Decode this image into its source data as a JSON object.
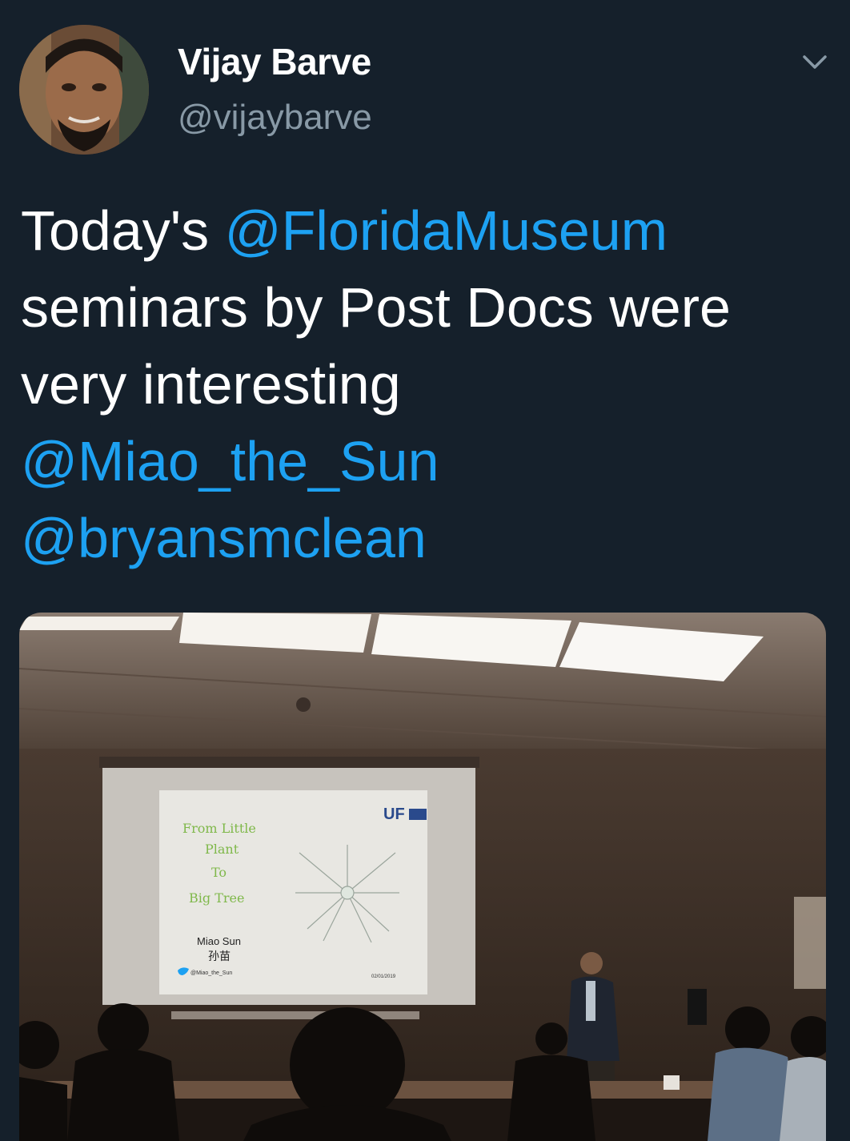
{
  "author": {
    "display_name": "Vijay Barve",
    "handle": "@vijaybarve"
  },
  "tweet": {
    "text_before": "Today's ",
    "mention_1": "@FloridaMuseum",
    "text_middle": "seminars by Post Docs were very interesting",
    "mention_2": "@Miao_the_Sun",
    "mention_3": "@bryansmclean"
  },
  "photo": {
    "slide": {
      "title_lines": [
        "From Little",
        "Plant",
        "To",
        "Big Tree"
      ],
      "logo": "UF",
      "presenter": "Miao Sun",
      "presenter_native": "孙苗",
      "twitter_handle": "@Miao_the_Sun",
      "date": "02/01/2019"
    }
  },
  "icons": {
    "caret": "chevron-down-icon",
    "bird": "twitter-bird-icon"
  },
  "colors": {
    "background": "#15202b",
    "mention": "#1da1f2",
    "secondary_text": "#8899a6"
  }
}
